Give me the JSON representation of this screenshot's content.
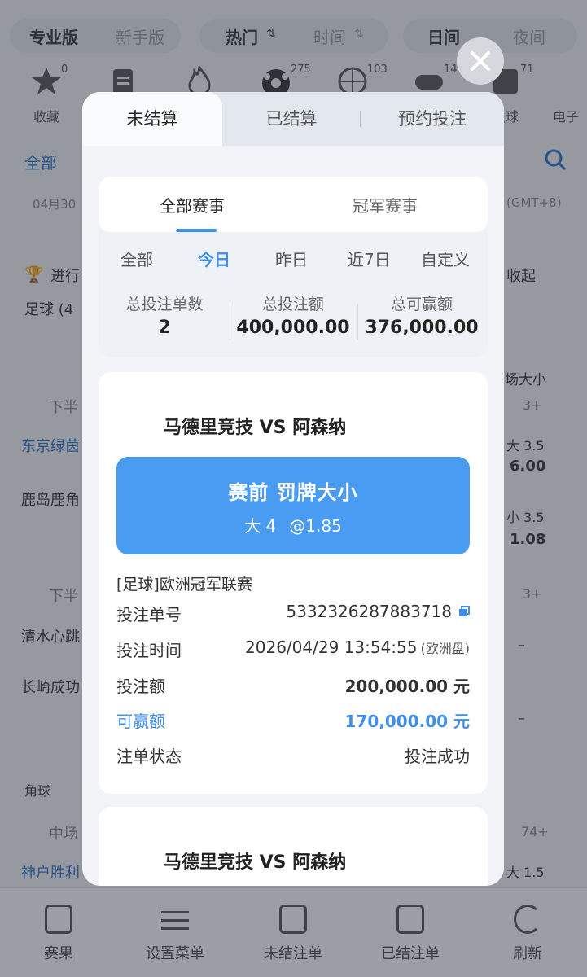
{
  "app": {
    "topbar": {
      "pro": "专业版",
      "novice": "新手版",
      "hot": "热门",
      "time": "时间",
      "day": "日间",
      "night": "夜间"
    },
    "categories": [
      {
        "label": "收藏",
        "count": "0",
        "icon": "star-icon"
      },
      {
        "label": "",
        "count": "",
        "icon": "clipboard-icon"
      },
      {
        "label": "",
        "count": "",
        "icon": "fire-icon"
      },
      {
        "label": "",
        "count": "275",
        "icon": "soccer-ball-icon"
      },
      {
        "label": "",
        "count": "103",
        "icon": "basketball-icon"
      },
      {
        "label": "",
        "count": "14",
        "icon": "gamepad-icon"
      },
      {
        "label": "足球",
        "count": "71",
        "icon": "fifa-icon"
      },
      {
        "label": "电子",
        "count": "",
        "icon": "esports-icon"
      }
    ],
    "filter_all": "全部",
    "date_label": "04月30",
    "timezone": "(GMT+8)",
    "live_label": "进行",
    "collapse_label": "收起",
    "sport_label": "足球 (4",
    "right_col_header": "场大小",
    "match_rows": [
      {
        "period": "下半",
        "team1": "东京绿茵",
        "team2": "鹿岛鹿角",
        "score": "3+",
        "line1": "大 3.5",
        "odd1": "6.00",
        "line2": "小 3.5",
        "odd2": "1.08"
      },
      {
        "period": "下半",
        "team1": "清水心跳",
        "team2": "长崎成功",
        "score": "3+",
        "line1": "–",
        "line2": "–"
      },
      {
        "period": "中场",
        "team1": "神户胜利",
        "score": "74+",
        "line1": "大 1.5"
      }
    ],
    "corner_label": "角球",
    "bottom_nav": [
      {
        "label": "赛果",
        "icon": "results-icon"
      },
      {
        "label": "设置菜单",
        "icon": "settings-sliders-icon"
      },
      {
        "label": "未结注单",
        "icon": "open-bets-icon"
      },
      {
        "label": "已结注单",
        "icon": "settled-bets-icon"
      },
      {
        "label": "刷新",
        "icon": "refresh-icon"
      }
    ]
  },
  "modal": {
    "tabs": [
      "未结算",
      "已结算",
      "预约投注"
    ],
    "filter_tabs": [
      "全部赛事",
      "冠军赛事"
    ],
    "dates": [
      "全部",
      "今日",
      "昨日",
      "近7日",
      "自定义"
    ],
    "stats": [
      {
        "label": "总投注单数",
        "value": "2"
      },
      {
        "label": "总投注额",
        "value": "400,000.00"
      },
      {
        "label": "总可赢额",
        "value": "376,000.00"
      }
    ],
    "bets": [
      {
        "match": "马德里竞技  VS  阿森纳",
        "market": "赛前 罚牌大小",
        "selection": "大 4",
        "odds": "@1.85",
        "league": "[足球]欧洲冠军联赛",
        "bet_no_label": "投注单号",
        "bet_no": "5332326287883718",
        "time_label": "投注时间",
        "time": "2026/04/29 13:54:55",
        "odds_type": "(欧洲盘)",
        "stake_label": "投注额",
        "stake": "200,000.00 元",
        "win_label": "可赢额",
        "win": "170,000.00 元",
        "status_label": "注单状态",
        "status": "投注成功"
      },
      {
        "match": "马德里竞技  VS  阿森纳"
      }
    ]
  },
  "colors": {
    "accent": "#3f8ee8",
    "selection_box": "#4a9bf2"
  }
}
